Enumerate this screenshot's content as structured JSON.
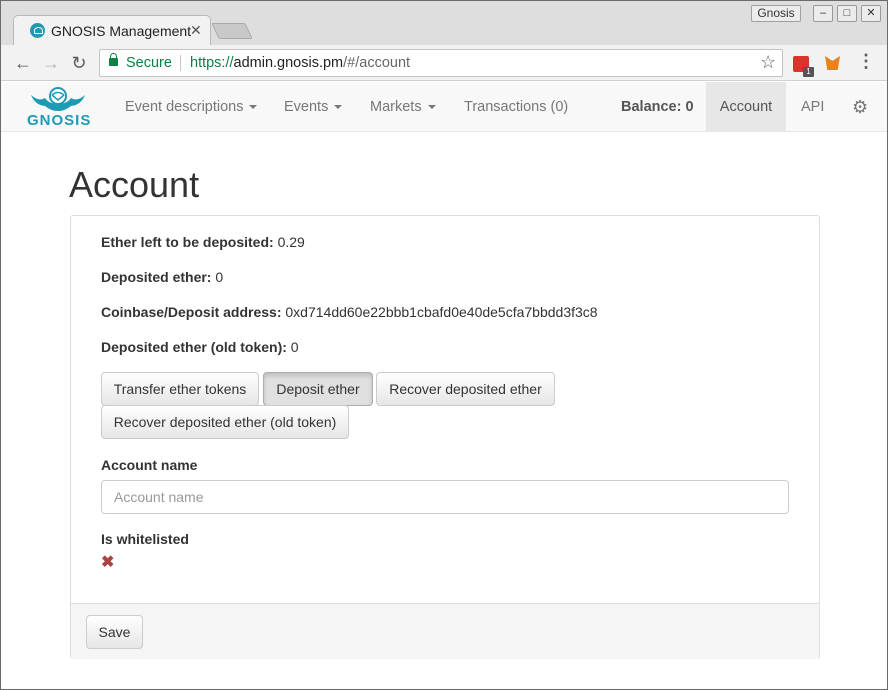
{
  "browser": {
    "tab_title": "GNOSIS Management",
    "tab_close": "✕",
    "profile_name": "Gnosis",
    "secure_label": "Secure",
    "url_protocol": "https://",
    "url_host": "admin.gnosis.pm",
    "url_path": "/#/account",
    "extension_badge": "1",
    "controls": {
      "minimize": "–",
      "maximize": "□",
      "close": "✕"
    },
    "icons": [
      "back-arrow-icon",
      "forward-arrow-icon",
      "reload-icon",
      "lock-icon",
      "star-icon",
      "menu-icon"
    ]
  },
  "navbar": {
    "brand": "GNOSIS",
    "items": [
      {
        "label": "Event descriptions",
        "dropdown": true
      },
      {
        "label": "Events",
        "dropdown": true
      },
      {
        "label": "Markets",
        "dropdown": true
      },
      {
        "label": "Transactions (0)",
        "dropdown": false
      }
    ],
    "balance": "Balance: 0",
    "account": "Account",
    "api": "API",
    "active_item": "Account"
  },
  "page": {
    "title": "Account",
    "fields": [
      {
        "label": "Ether left to be deposited:",
        "value": "0.29"
      },
      {
        "label": "Deposited ether:",
        "value": "0"
      },
      {
        "label": "Coinbase/Deposit address:",
        "value": "0xd714dd60e22bbb1cbafd0e40de5cfa7bbdd3f3c8"
      },
      {
        "label": "Deposited ether (old token):",
        "value": "0"
      }
    ],
    "buttons": {
      "transfer": "Transfer ether tokens",
      "deposit": "Deposit ether",
      "recover": "Recover deposited ether",
      "recover_old": "Recover deposited ether (old token)"
    },
    "account_name_label": "Account name",
    "account_name_placeholder": "Account name",
    "account_name_value": "",
    "whitelisted_label": "Is whitelisted",
    "whitelisted_value": "✖",
    "save": "Save"
  },
  "colors": {
    "brand": "#1d9bb3",
    "secure": "#0b8043",
    "danger": "#a94442"
  }
}
